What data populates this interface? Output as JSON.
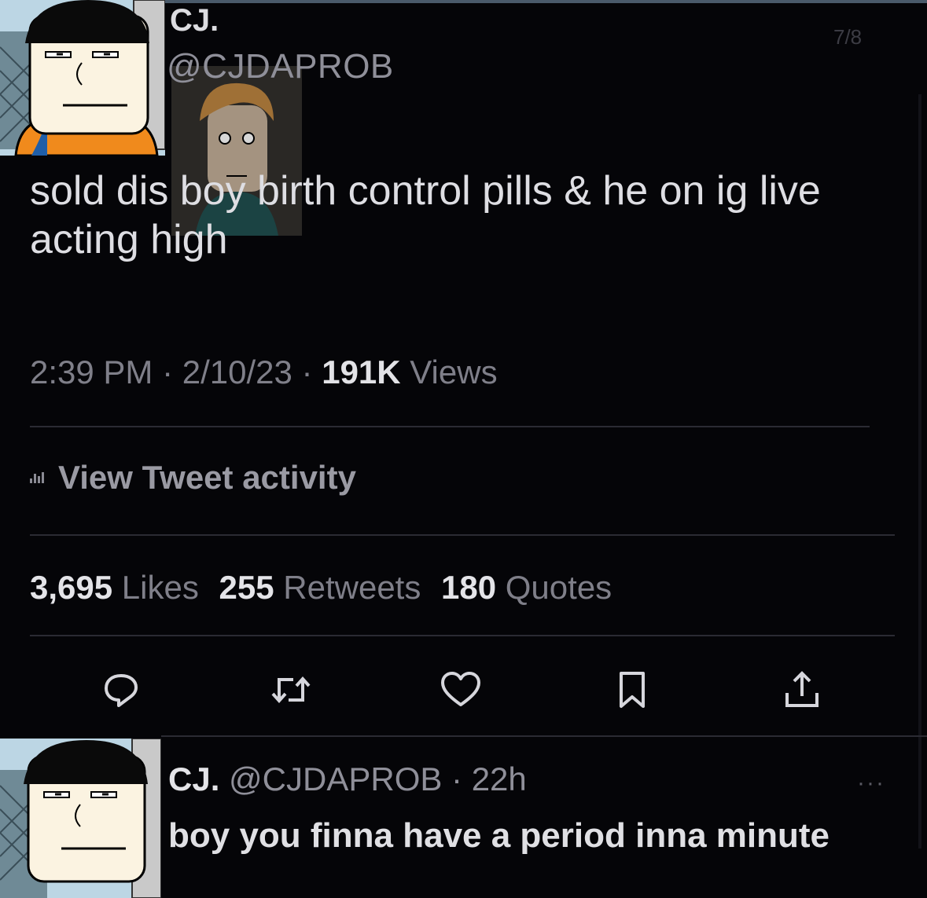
{
  "tweet": {
    "display_name": "CJ.",
    "handle": "@CJDAPROB",
    "counter": "7/8",
    "text": "sold dis boy birth control pills & he on ig live acting high",
    "time": "2:39 PM",
    "date": "2/10/23",
    "views_count": "191K",
    "views_label": "Views",
    "activity_label": "View Tweet activity",
    "likes_count": "3,695",
    "likes_label": "Likes",
    "retweets_count": "255",
    "retweets_label": "Retweets",
    "quotes_count": "180",
    "quotes_label": "Quotes",
    "actions": [
      "reply-icon",
      "retweet-icon",
      "like-icon",
      "bookmark-icon",
      "share-icon"
    ]
  },
  "reply": {
    "display_name": "CJ.",
    "handle": "@CJDAPROB",
    "age": "22h",
    "text": "boy you finna have a period inna minute",
    "more": "···"
  },
  "colors": {
    "background": "#050508",
    "text": "#e7e7ea",
    "muted": "#7f7f89",
    "avatar_shirt": "#f08a1c",
    "avatar_hair": "#0a0a0a"
  }
}
